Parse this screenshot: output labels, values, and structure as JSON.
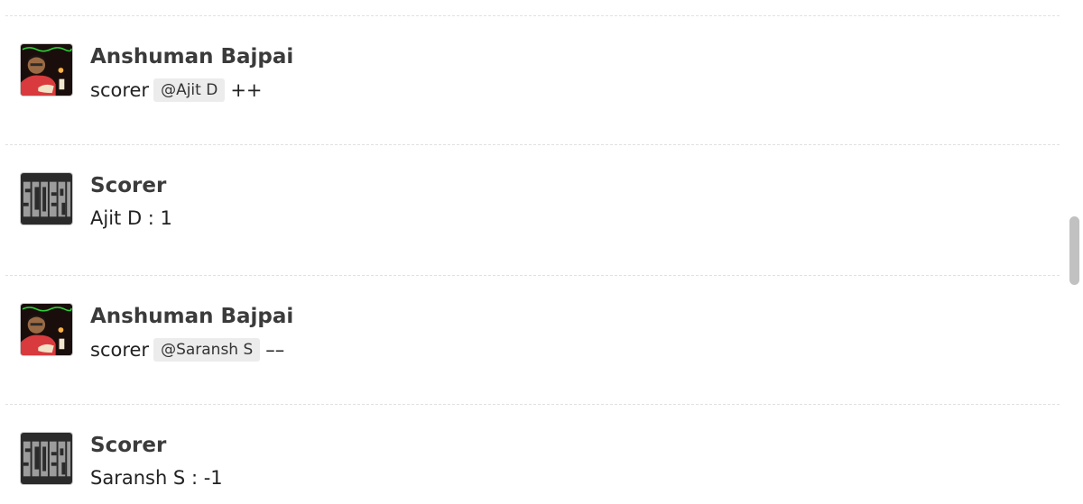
{
  "messages": [
    {
      "author": "Anshuman Bajpai",
      "avatar": "user-photo-avatar",
      "text_before": "scorer",
      "mention": "@Ajit D",
      "text_after": "++"
    },
    {
      "author": "Scorer",
      "avatar": "scorer-logo-avatar",
      "text": "Ajit D : 1"
    },
    {
      "author": "Anshuman Bajpai",
      "avatar": "user-photo-avatar",
      "text_before": "scorer",
      "mention": "@Saransh S",
      "text_after": "––"
    },
    {
      "author": "Scorer",
      "avatar": "scorer-logo-avatar",
      "text": "Saransh S : -1"
    }
  ],
  "scrollbar": {
    "position": 0.55
  },
  "colors": {
    "divider": "#e1e1e1",
    "mention_bg": "#ececec",
    "author_text": "#3b3b3b",
    "scrollbar_thumb": "#c1c1c1"
  }
}
